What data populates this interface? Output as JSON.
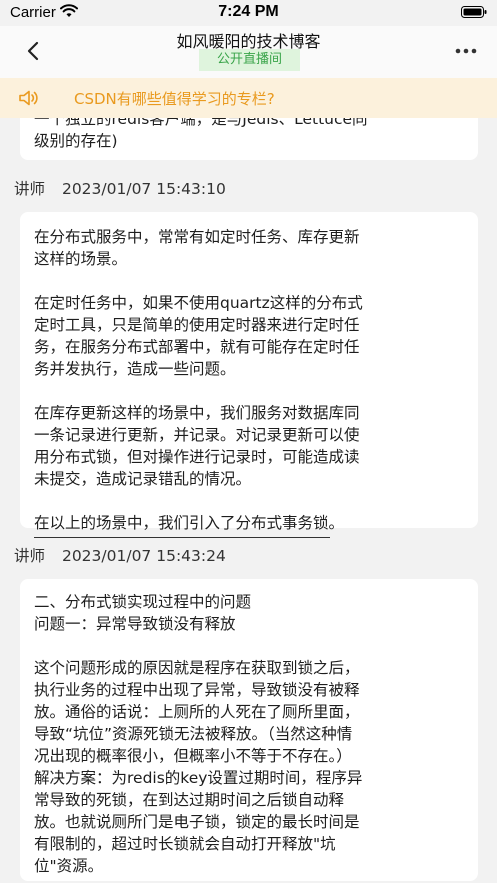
{
  "status_bar": {
    "carrier": "Carrier",
    "time": "7:24 PM"
  },
  "nav": {
    "title": "如风暖阳的技术博客",
    "badge": "公开直播间"
  },
  "notice": {
    "text": "CSDN有哪些值得学习的专栏?"
  },
  "messages": [
    {
      "lines": [
        "一个独立的redis客户端，是与Jedis、Lettuce同",
        "级别的存在)"
      ]
    },
    {
      "author": "讲师",
      "timestamp": "2023/01/07 15:43:10",
      "lines": [
        "在分布式服务中，常常有如定时任务、库存更新",
        "这样的场景。",
        "",
        "在定时任务中，如果不使用quartz这样的分布式",
        "定时工具，只是简单的使用定时器来进行定时任",
        "务，在服务分布式部署中，就有可能存在定时任",
        "务并发执行，造成一些问题。",
        "",
        "在库存更新这样的场景中，我们服务对数据库同",
        "一条记录进行更新，并记录。对记录更新可以使",
        "用分布式锁，但对操作进行记录时，可能造成读",
        "未提交，造成记录错乱的情况。",
        "",
        "在以上的场景中，我们引入了分布式事务锁。"
      ]
    },
    {
      "author": "讲师",
      "timestamp": "2023/01/07 15:43:24",
      "lines": [
        "二、分布式锁实现过程中的问题",
        "问题一：异常导致锁没有释放",
        "",
        "这个问题形成的原因就是程序在获取到锁之后，",
        "执行业务的过程中出现了异常，导致锁没有被释",
        "放。通俗的话说：上厕所的人死在了厕所里面，",
        "导致“坑位”资源死锁无法被释放。（当然这种情",
        "况出现的概率很小，但概率小不等于不存在。）",
        "解决方案：为redis的key设置过期时间，程序异",
        "常导致的死锁，在到达过期时间之后锁自动释",
        "放。也就说厕所门是电子锁，锁定的最长时间是",
        "有限制的，超过时长锁就会自动打开释放\"坑",
        "位\"资源。"
      ]
    }
  ]
}
